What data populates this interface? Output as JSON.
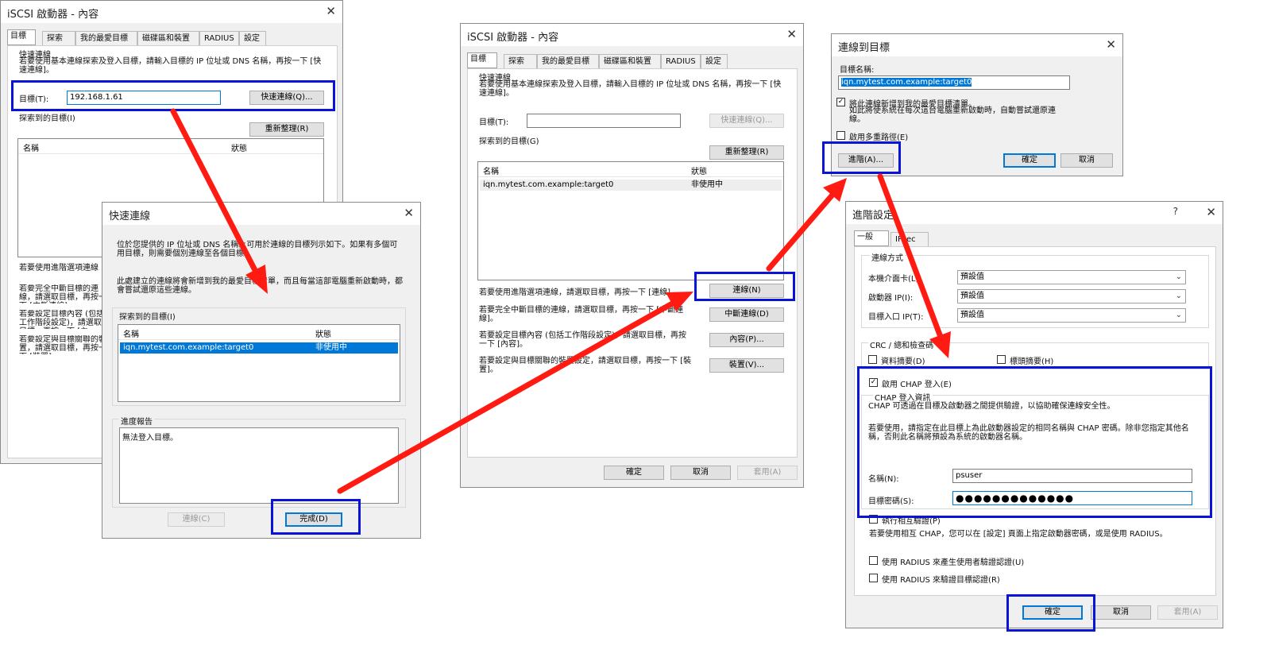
{
  "colors": {
    "highlight": "#0a14d8",
    "arrow": "#ff1a12",
    "selection": "#0078d7"
  },
  "dialog1": {
    "title": "iSCSI 啟動器 - 內容",
    "close_icon": "close-icon",
    "tabs": [
      "目標",
      "探索",
      "我的最愛目標",
      "磁碟區和裝置",
      "RADIUS",
      "設定"
    ],
    "quick_connect_group": "快速連線",
    "quick_connect_desc": "若要使用基本連線探索及登入目標，請輸入目標的 IP 位址或 DNS 名稱，再按一下 [快速連線]。",
    "target_label": "目標(T):",
    "target_value": "192.168.1.61",
    "quick_connect_button": "快速連線(Q)...",
    "discovered_label": "探索到的目標(I)",
    "refresh_button": "重新整理(R)",
    "col_name": "名稱",
    "col_status": "狀態",
    "advanced_text": "若要使用進階選項連線",
    "disconnect_text": "若要完全中斷目標的連線，請選取目標，再按一下 [中斷連線]。",
    "properties_text": "若要設定目標內容 (包括工作階段設定)，請選取目標，再按一下 [內容]。",
    "devices_text": "若要設定與目標關聯的裝置，請選取目標，再按一下 [裝置]。"
  },
  "dialog2": {
    "title": "快速連線",
    "close_icon": "close-icon",
    "desc1": "位於您提供的 IP 位址或 DNS 名稱上可用於連線的目標列示如下。如果有多個可用目標，則需要個別連線至各個目標。",
    "desc2": "此處建立的連線將會新增到我的最愛目標清單，而且每當這部電腦重新啟動時，都會嘗試還原這些連線。",
    "discovered_label": "探索到的目標(I)",
    "col_name": "名稱",
    "col_status": "狀態",
    "rows": [
      {
        "name": "iqn.mytest.com.example:target0",
        "status": "非使用中"
      }
    ],
    "progress_label": "進度報告",
    "progress_text": "無法登入目標。",
    "connect_button": "連線(C)",
    "done_button": "完成(D)"
  },
  "dialog3": {
    "title": "iSCSI 啟動器 - 內容",
    "close_icon": "close-icon",
    "tabs": [
      "目標",
      "探索",
      "我的最愛目標",
      "磁碟區和裝置",
      "RADIUS",
      "設定"
    ],
    "quick_connect_group": "快速連線",
    "quick_connect_desc": "若要使用基本連線探索及登入目標，請輸入目標的 IP 位址或 DNS 名稱，再按一下 [快速連線]。",
    "target_label": "目標(T):",
    "target_value": "",
    "quick_connect_button": "快速連線(Q)...",
    "discovered_label": "探索到的目標(G)",
    "refresh_button": "重新整理(R)",
    "col_name": "名稱",
    "col_status": "狀態",
    "rows": [
      {
        "name": "iqn.mytest.com.example:target0",
        "status": "非使用中"
      }
    ],
    "advanced_text": "若要使用進階選項連線，請選取目標，再按一下 [連線]。",
    "connect_button": "連線(N)",
    "disconnect_text": "若要完全中斷目標的連線，請選取目標，再按一下 [中斷連線]。",
    "disconnect_button": "中斷連線(D)",
    "properties_text": "若要設定目標內容 (包括工作階段設定)，請選取目標，再按一下 [內容]。",
    "properties_button": "內容(P)...",
    "devices_text": "若要設定與目標關聯的裝置設定，請選取目標，再按一下 [裝置]。",
    "devices_button": "裝置(V)...",
    "ok_button": "確定",
    "cancel_button": "取消",
    "apply_button": "套用(A)"
  },
  "dialog4": {
    "title": "連線到目標",
    "close_icon": "close-icon",
    "target_name_label": "目標名稱:",
    "target_name_value": "iqn.mytest.com.example:target0",
    "add_favorites_label": "將此連線新增到我的最愛目標清單。",
    "add_favorites_desc": "如此將使系統在每次這台電腦重新啟動時，自動嘗試還原連線。",
    "add_favorites_checked": true,
    "multipath_label": "啟用多重路徑(E)",
    "multipath_checked": false,
    "advanced_button": "進階(A)...",
    "ok_button": "確定",
    "cancel_button": "取消"
  },
  "dialog5": {
    "title": "進階設定",
    "help_icon": "question-mark-icon",
    "close_icon": "close-icon",
    "tabs": [
      "一般",
      "IPsec"
    ],
    "connect_via_group": "連線方式",
    "local_adapter_label": "本機介面卡(L):",
    "local_adapter_value": "預設值",
    "initiator_ip_label": "啟動器 IP(I):",
    "initiator_ip_value": "預設值",
    "target_portal_label": "目標入口 IP(T):",
    "target_portal_value": "預設值",
    "crc_group": "CRC / 總和檢查碼",
    "data_digest_label": "資料摘要(D)",
    "header_digest_label": "標頭摘要(H)",
    "chap_enable_label": "啟用 CHAP 登入(E)",
    "chap_enable_checked": true,
    "chap_info_group": "CHAP 登入資訊",
    "chap_desc1": "CHAP 可透過在目標及啟動器之間提供驗證，以協助確保連線安全性。",
    "chap_desc2": "若要使用，請指定在此目標上為此啟動器設定的相同名稱與 CHAP 密碼。除非您指定其他名稱，否則此名稱將預設為系統的啟動器名稱。",
    "name_label": "名稱(N):",
    "name_value": "psuser",
    "secret_label": "目標密碼(S):",
    "secret_value": "●●●●●●●●●●●●●",
    "mutual_label": "執行相互驗證(P)",
    "mutual_desc": "若要使用相互 CHAP，您可以在 [設定] 頁面上指定啟動器密碼，或是使用 RADIUS。",
    "radius_user_label": "使用 RADIUS 來產生使用者驗證認證(U)",
    "radius_target_label": "使用 RADIUS 來驗證目標認證(R)",
    "ok_button": "確定",
    "cancel_button": "取消",
    "apply_button": "套用(A)"
  }
}
